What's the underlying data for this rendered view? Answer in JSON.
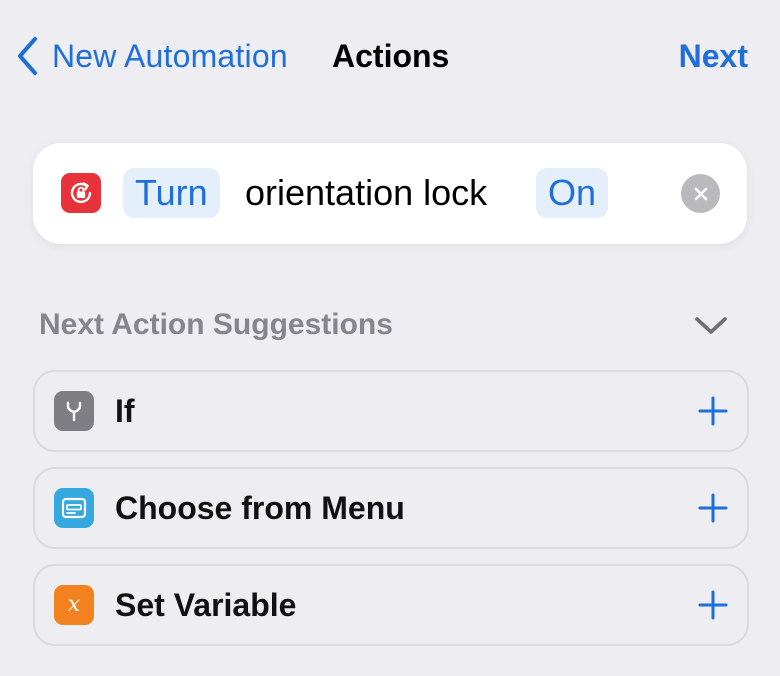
{
  "nav": {
    "back_label": "New Automation",
    "title": "Actions",
    "next_label": "Next"
  },
  "action": {
    "icon": "orientation-lock-icon",
    "verb": "Turn",
    "text": "orientation lock",
    "state": "On"
  },
  "suggestions": {
    "title": "Next Action Suggestions",
    "items": [
      {
        "label": "If",
        "icon": "branch-icon",
        "color": "#7E7E84"
      },
      {
        "label": "Choose from Menu",
        "icon": "menu-icon",
        "color": "#35A8DF"
      },
      {
        "label": "Set Variable",
        "icon": "variable-x-icon",
        "color": "#F28220",
        "glyph": "x"
      }
    ]
  },
  "colors": {
    "accent": "#1E6FD9",
    "background": "#EDEDF2",
    "action_icon": "#E8323A",
    "token_bg": "#E5EEFB"
  }
}
